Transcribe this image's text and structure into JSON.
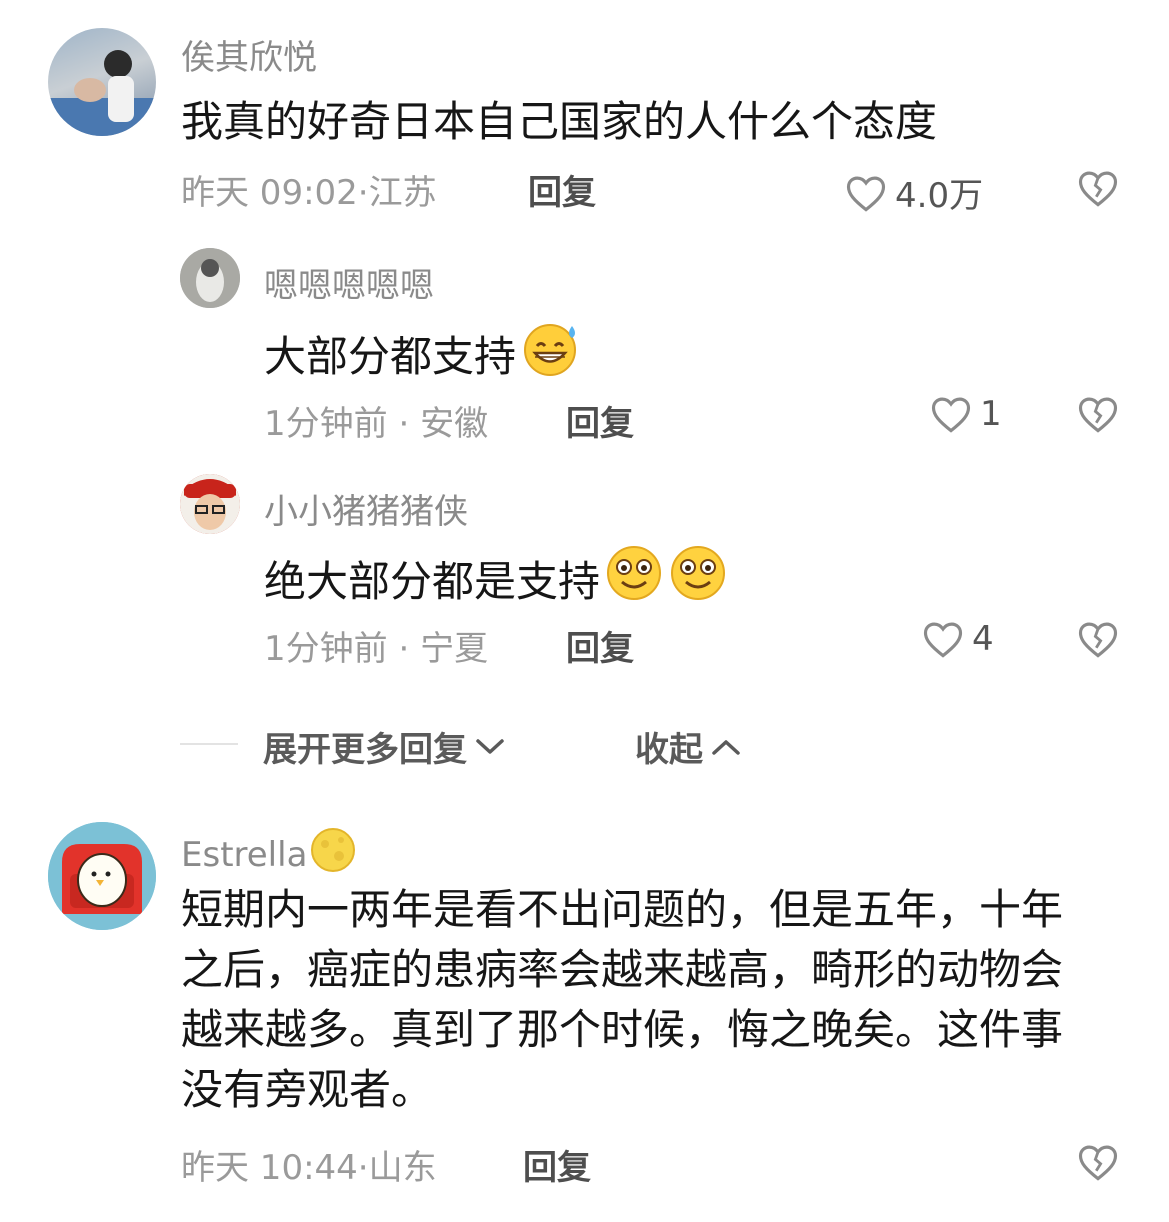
{
  "comments": [
    {
      "username": "俟其欣悦",
      "text": "我真的好奇日本自己国家的人什么个态度",
      "time": "昨天 09:02",
      "location": "江苏",
      "reply_label": "回复",
      "likes": "4.0万",
      "replies": [
        {
          "username": "嗯嗯嗯嗯嗯",
          "text": "大部分都支持",
          "time": "1分钟前",
          "location": "安徽",
          "reply_label": "回复",
          "likes": "1"
        },
        {
          "username": "小小猪猪猪侠",
          "text": "绝大部分都是支持",
          "time": "1分钟前",
          "location": "宁夏",
          "reply_label": "回复",
          "likes": "4"
        }
      ],
      "expand_more": "展开更多回复",
      "collapse": "收起"
    },
    {
      "username": "Estrella",
      "text": "短期内一两年是看不出问题的，但是五年，十年之后，癌症的患病率会越来越高，畸形的动物会越来越多。真到了那个时候，悔之晚矣。这件事没有旁观者。",
      "time": "昨天 10:44",
      "location": "山东",
      "reply_label": "回复"
    }
  ],
  "meta_separator": "·",
  "icons": {
    "like": "heart-outline-icon",
    "dislike": "broken-heart-icon",
    "expand": "chevron-down-icon",
    "collapse": "chevron-up-icon"
  }
}
